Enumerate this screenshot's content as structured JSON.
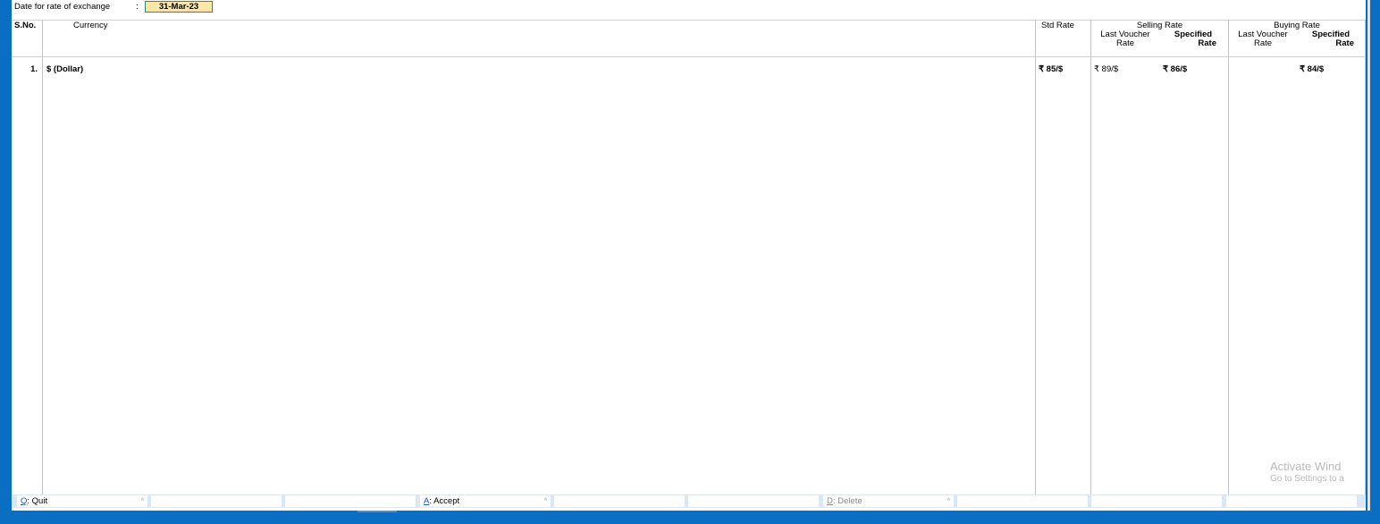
{
  "date": {
    "label": "Date for rate of exchange",
    "colon": ":",
    "value": "31-Mar-23"
  },
  "columns": {
    "sno": "S.No.",
    "currency": "Currency",
    "std_rate": "Std Rate",
    "selling_rate": "Selling Rate",
    "buying_rate": "Buying Rate",
    "last_voucher_line1": "Last Voucher",
    "last_voucher_line2": "Rate",
    "specified_line1": "Specified",
    "specified_line2": "Rate"
  },
  "rows": [
    {
      "sno": "1.",
      "currency": "$ (Dollar)",
      "std_rate": "₹ 85/$",
      "selling_last_voucher": "₹ 89/$",
      "selling_specified": "₹ 86/$",
      "buying_last_voucher": "",
      "buying_specified": "₹ 84/$"
    }
  ],
  "footer": {
    "quit_key": "Q",
    "quit_label": ": Quit",
    "accept_key": "A",
    "accept_label": ": Accept",
    "delete_key": "D",
    "delete_label": ": Delete"
  },
  "watermark": {
    "title": "Activate Wind",
    "subtitle": "Go to Settings to a"
  },
  "colors": {
    "frame_blue": "#0a6fc2",
    "date_field_bg": "#fbe6a8",
    "footer_bg": "#d9e8f7"
  }
}
